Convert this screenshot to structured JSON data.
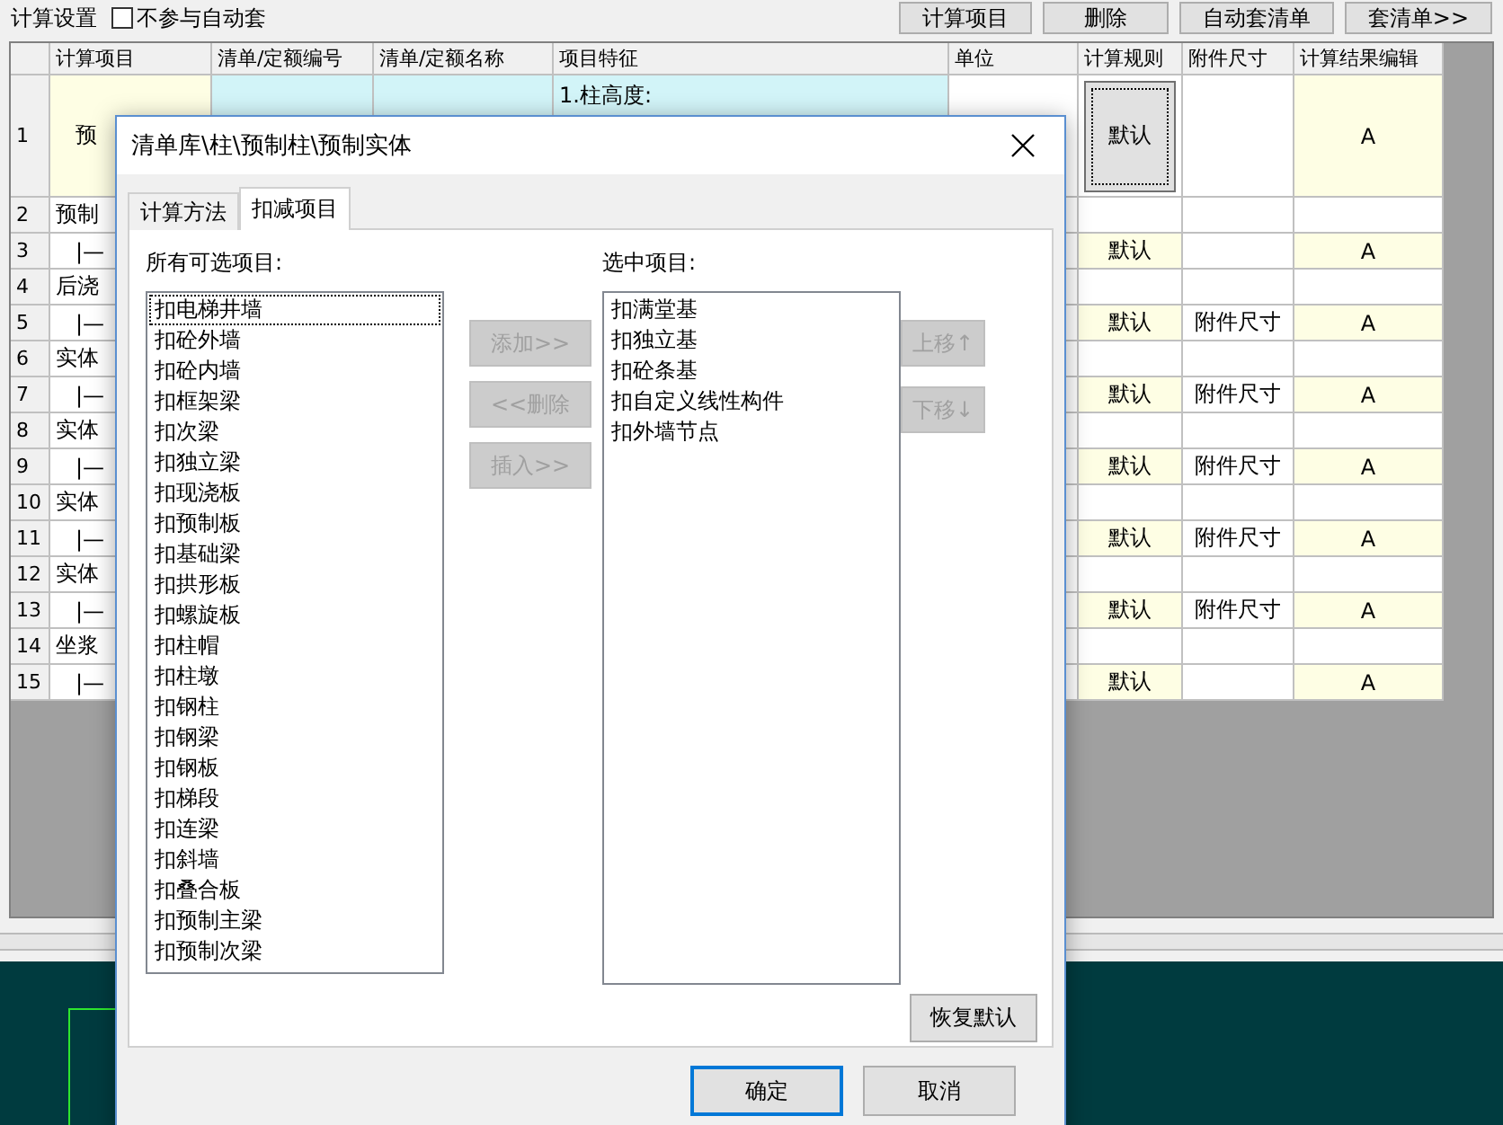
{
  "toolbar": {
    "label": "计算设置",
    "auto_checkbox": {
      "label": "不参与自动套",
      "checked": false
    },
    "buttons": [
      "计算项目",
      "删除",
      "自动套清单",
      "套清单>>"
    ]
  },
  "table": {
    "columns": [
      "计算项目",
      "清单/定额编号",
      "清单/定额名称",
      "项目特征",
      "单位",
      "计算规则",
      "附件尺寸",
      "计算结果编辑"
    ],
    "rows": [
      {
        "num": "1",
        "item": "预",
        "feature": "1.柱高度:",
        "rule": "默认",
        "result": "A",
        "kind": "main",
        "focused": true
      },
      {
        "num": "2",
        "item": "预制",
        "kind": "group"
      },
      {
        "num": "3",
        "item": "|—",
        "rule": "默认",
        "result": "A",
        "kind": "sub"
      },
      {
        "num": "4",
        "item": "后浇",
        "kind": "group"
      },
      {
        "num": "5",
        "item": "|—",
        "rule": "默认",
        "attach": "附件尺寸",
        "result": "A",
        "kind": "sub"
      },
      {
        "num": "6",
        "item": "实体",
        "kind": "group"
      },
      {
        "num": "7",
        "item": "|—",
        "rule": "默认",
        "attach": "附件尺寸",
        "result": "A",
        "kind": "sub"
      },
      {
        "num": "8",
        "item": "实体",
        "kind": "group"
      },
      {
        "num": "9",
        "item": "|—",
        "rule": "默认",
        "attach": "附件尺寸",
        "result": "A",
        "kind": "sub"
      },
      {
        "num": "10",
        "item": "实体",
        "kind": "group"
      },
      {
        "num": "11",
        "item": "|—",
        "rule": "默认",
        "attach": "附件尺寸",
        "result": "A",
        "kind": "sub"
      },
      {
        "num": "12",
        "item": "实体",
        "kind": "group"
      },
      {
        "num": "13",
        "item": "|—",
        "rule": "默认",
        "attach": "附件尺寸",
        "result": "A",
        "kind": "sub"
      },
      {
        "num": "14",
        "item": "坐浆",
        "kind": "group"
      },
      {
        "num": "15",
        "item": "|—",
        "rule": "默认",
        "result": "A",
        "kind": "sub"
      }
    ]
  },
  "dialog": {
    "title": "清单库\\柱\\预制柱\\预制实体",
    "tabs": [
      {
        "label": "计算方法",
        "selected": false
      },
      {
        "label": "扣减项目",
        "selected": true
      }
    ],
    "available_label": "所有可选项目:",
    "available_items": [
      {
        "label": "扣电梯井墙",
        "focused": true
      },
      {
        "label": "扣砼外墙",
        "focused": false
      },
      {
        "label": "扣砼内墙",
        "focused": false
      },
      {
        "label": "扣框架梁",
        "focused": false
      },
      {
        "label": "扣次梁",
        "focused": false
      },
      {
        "label": "扣独立梁",
        "focused": false
      },
      {
        "label": "扣现浇板",
        "focused": false
      },
      {
        "label": "扣预制板",
        "focused": false
      },
      {
        "label": "扣基础梁",
        "focused": false
      },
      {
        "label": "扣拱形板",
        "focused": false
      },
      {
        "label": "扣螺旋板",
        "focused": false
      },
      {
        "label": "扣柱帽",
        "focused": false
      },
      {
        "label": "扣柱墩",
        "focused": false
      },
      {
        "label": "扣钢柱",
        "focused": false
      },
      {
        "label": "扣钢梁",
        "focused": false
      },
      {
        "label": "扣钢板",
        "focused": false
      },
      {
        "label": "扣梯段",
        "focused": false
      },
      {
        "label": "扣连梁",
        "focused": false
      },
      {
        "label": "扣斜墙",
        "focused": false
      },
      {
        "label": "扣叠合板",
        "focused": false
      },
      {
        "label": "扣预制主梁",
        "focused": false
      },
      {
        "label": "扣预制次梁",
        "focused": false
      }
    ],
    "selected_label": "选中项目:",
    "selected_items": [
      "扣满堂基",
      "扣独立基",
      "扣砼条基",
      "扣自定义线性构件",
      "扣外墙节点"
    ],
    "middle_buttons": [
      {
        "label": "添加>>",
        "disabled": true
      },
      {
        "label": "<<删除",
        "disabled": true
      },
      {
        "label": "插入>>",
        "disabled": true
      }
    ],
    "order_buttons": [
      {
        "label": "上移↑",
        "disabled": true
      },
      {
        "label": "下移↓",
        "disabled": true
      }
    ],
    "restore_button": "恢复默认",
    "ok_button": "确定",
    "cancel_button": "取消"
  }
}
